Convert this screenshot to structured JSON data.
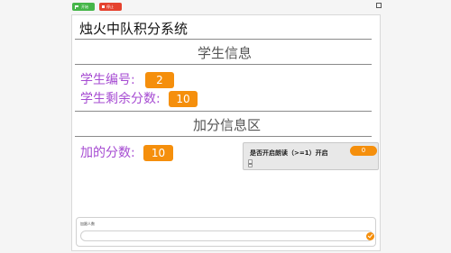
{
  "toolbar": {
    "run_label": "开始",
    "stop_label": "停止"
  },
  "stage": {
    "title": "烛火中队积分系统",
    "student_section": "学生信息",
    "student_id_label": "学生编号:",
    "student_id_value": "2",
    "remaining_score_label": "学生剩余分数:",
    "remaining_score_value": "10",
    "add_section": "加分信息区",
    "added_score_label": "加的分数:",
    "added_score_value": "10"
  },
  "readout": {
    "label": "是否开启朗读（>=1）开启",
    "value": "0"
  },
  "ask": {
    "prompt": "加跟人数",
    "value": ""
  },
  "colors": {
    "orange": "#f58f0c",
    "purple": "#a64bd2",
    "run": "#45b649",
    "stop": "#e5422e"
  }
}
